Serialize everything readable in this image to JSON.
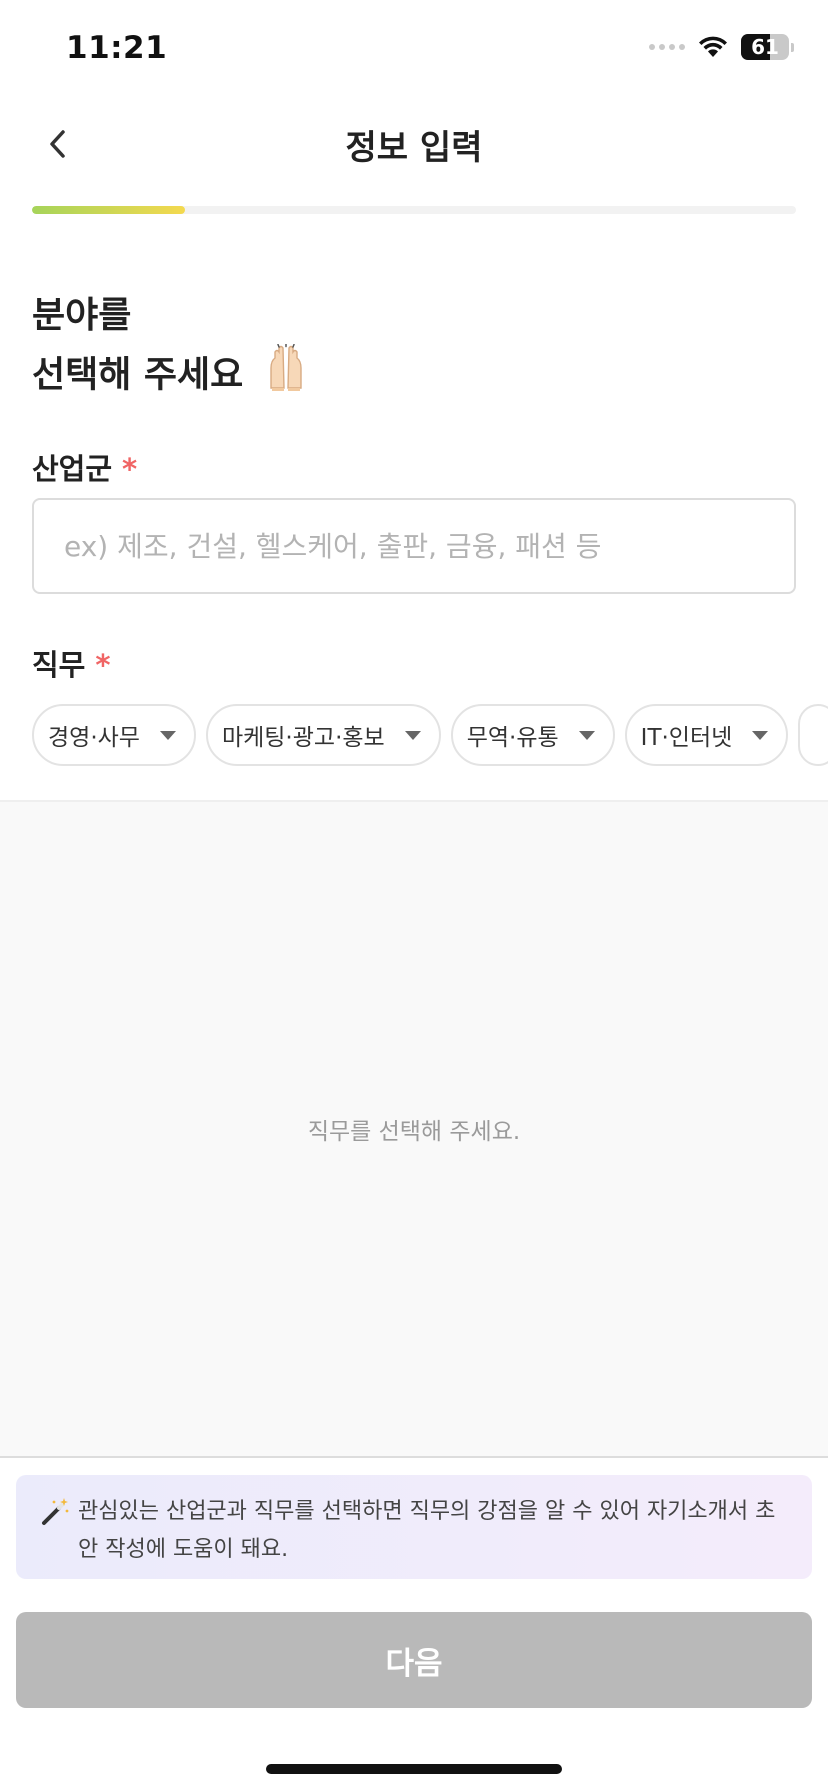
{
  "status_bar": {
    "time": "11:21",
    "battery": "61",
    "battery_level": 0.61
  },
  "nav": {
    "title": "정보 입력"
  },
  "progress": {
    "value": 0.2,
    "fill_colors": [
      "#a6d45a",
      "#f4d94f"
    ]
  },
  "heading": {
    "line1": "분야를",
    "line2": "선택해 주세요",
    "emoji": "raised-hands-icon"
  },
  "industry": {
    "label": "산업군",
    "required_mark": "*",
    "value": "",
    "placeholder": "ex) 제조, 건설, 헬스케어, 출판, 금융, 패션 등"
  },
  "job": {
    "label": "직무",
    "required_mark": "*",
    "chips": [
      {
        "label": "경영·사무"
      },
      {
        "label": "마케팅·광고·홍보"
      },
      {
        "label": "무역·유통"
      },
      {
        "label": "IT·인터넷"
      }
    ]
  },
  "empty_state": {
    "text": "직무를 선택해 주세요."
  },
  "tip": {
    "icon": "magic-wand-icon",
    "text": "관심있는 산업군과 직무를 선택하면 직무의 강점을 알 수 있어 자기소개서 초안 작성에 도움이 돼요."
  },
  "next_button": {
    "label": "다음"
  },
  "colors": {
    "accent_required": "#f06565",
    "button_disabled": "#b9b9b9",
    "tip_bg": "#ebebfb"
  }
}
